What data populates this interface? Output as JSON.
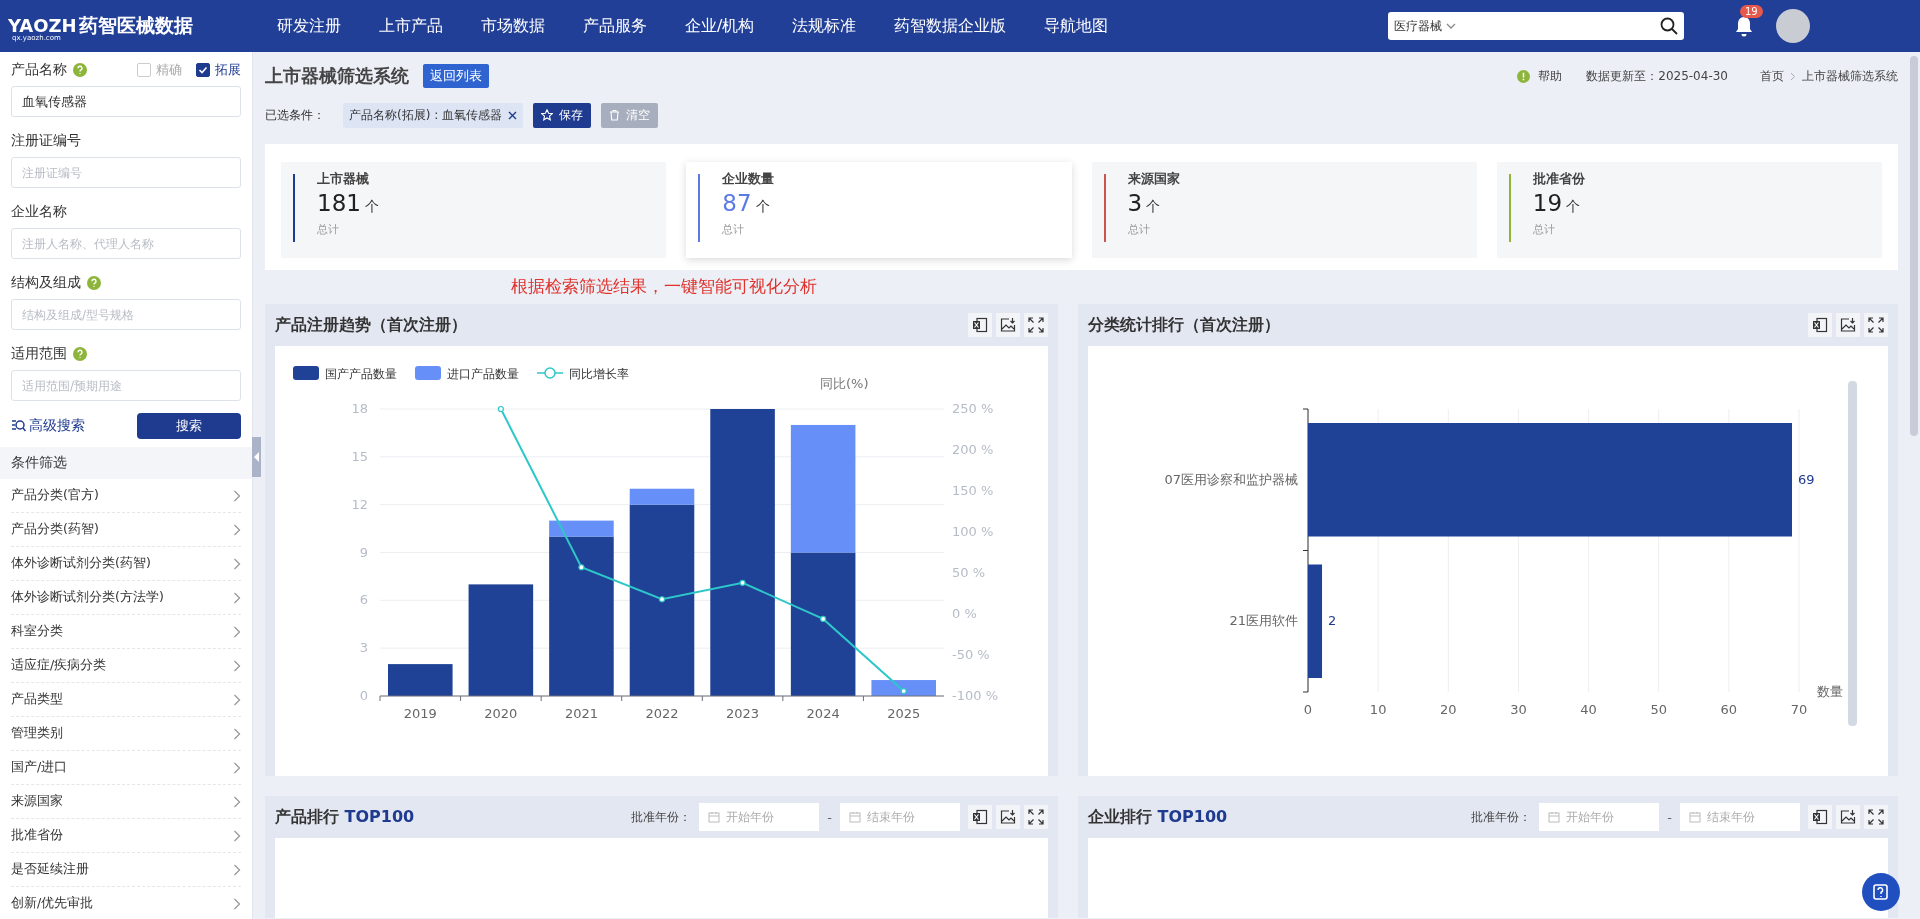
{
  "topbar": {
    "logo": "YAOZH",
    "logo_name": "药智医械数据",
    "logo_url": "qx.yaozh.com",
    "nav": [
      "研发注册",
      "上市产品",
      "市场数据",
      "产品服务",
      "企业/机构",
      "法规标准",
      "药智数据企业版",
      "导航地图"
    ],
    "search": {
      "scope": "医疗器械"
    },
    "notifications": "19"
  },
  "sidebar": {
    "fields": [
      {
        "label": "产品名称",
        "help": true,
        "value": "血氧传感器",
        "options": [
          {
            "label": "精确",
            "checked": false
          },
          {
            "label": "拓展",
            "checked": true
          }
        ]
      },
      {
        "label": "注册证编号",
        "help": false,
        "placeholder": "注册证编号"
      },
      {
        "label": "企业名称",
        "help": false,
        "placeholder": "注册人名称、代理人名称"
      },
      {
        "label": "结构及组成",
        "help": true,
        "placeholder": "结构及组成/型号规格"
      },
      {
        "label": "适用范围",
        "help": true,
        "placeholder": "适用范围/预期用途"
      }
    ],
    "advanced": "高级搜索",
    "search_button": "搜索",
    "filter_title": "条件筛选",
    "filters": [
      "产品分类(官方)",
      "产品分类(药智)",
      "体外诊断试剂分类(药智)",
      "体外诊断试剂分类(方法学)",
      "科室分类",
      "适应症/疾病分类",
      "产品类型",
      "管理类别",
      "国产/进口",
      "来源国家",
      "批准省份",
      "是否延续注册",
      "创新/优先审批"
    ]
  },
  "header": {
    "title": "上市器械筛选系统",
    "back_button": "返回列表",
    "help": "帮助",
    "updated": "数据更新至：2025-04-30",
    "breadcrumb": [
      "首页",
      "上市器械筛选系统"
    ]
  },
  "conditions": {
    "label": "已选条件：",
    "tags": [
      "产品名称(拓展) : 血氧传感器"
    ],
    "buttons": [
      {
        "label": "保存",
        "disabled": false
      },
      {
        "label": "清空",
        "disabled": true
      }
    ]
  },
  "stats": [
    {
      "label": "上市器械",
      "value": "181",
      "unit": "个",
      "note": "总计",
      "color": "#1f3b8f",
      "selected": false
    },
    {
      "label": "企业数量",
      "value": "87",
      "unit": "个",
      "note": "总计",
      "color": "#5b7be0",
      "selected": true
    },
    {
      "label": "来源国家",
      "value": "3",
      "unit": "个",
      "note": "总计",
      "color": "#c9554e",
      "selected": false
    },
    {
      "label": "批准省份",
      "value": "19",
      "unit": "个",
      "note": "总计",
      "color": "#8db53b",
      "selected": false
    }
  ],
  "annotation": "根据检索筛选结果，一键智能可视化分析",
  "trend_card": {
    "title": "产品注册趋势（首次注册）",
    "layers": [
      {
        "chart_data": {
          "type": "bar",
          "stacked": true,
          "legend": "top",
          "grid": true,
          "categories": [
            "2019",
            "2020",
            "2021",
            "2022",
            "2023",
            "2024",
            "2025"
          ],
          "series": [
            {
              "name": "国产产品数量",
              "color": "#1f4196",
              "values": [
                2,
                7,
                10,
                12,
                18,
                9,
                0
              ]
            },
            {
              "name": "进口产品数量",
              "color": "#6690f8",
              "values": [
                0,
                0,
                1,
                1,
                0,
                8,
                1
              ]
            }
          ],
          "ylim": [
            0,
            18
          ],
          "yticks": [
            0,
            3,
            6,
            9,
            12,
            15,
            18
          ]
        }
      },
      {
        "chart_data": {
          "type": "line",
          "legend": "top",
          "ylabel": "同比(%)",
          "ylim": [
            -100,
            250
          ],
          "yticks": [
            {
              "value": -100,
              "label": "-100 %"
            },
            {
              "value": -50,
              "label": "-50 %"
            },
            {
              "value": 0,
              "label": "0 %"
            },
            {
              "value": 50,
              "label": "50 %"
            },
            {
              "value": 100,
              "label": "100 %"
            },
            {
              "value": 150,
              "label": "150 %"
            },
            {
              "value": 200,
              "label": "200 %"
            },
            {
              "value": 250,
              "label": "250 %"
            }
          ],
          "series": [
            {
              "name": "同比增长率",
              "color": "#2ec7c9",
              "marker": "circle",
              "values": [
                null,
                250,
                57,
                18,
                38,
                -6,
                -94
              ]
            }
          ]
        }
      }
    ]
  },
  "class_card": {
    "title": "分类统计排行（首次注册）",
    "chart_data": {
      "type": "bar",
      "orientation": "horizontal",
      "grid": true,
      "categories": [
        "07医用诊察和监护器械",
        "21医用软件"
      ],
      "series": [
        {
          "color": "#1f4196",
          "values": [
            69,
            2
          ]
        }
      ],
      "xlabel": "数量",
      "xlim": [
        0,
        70
      ],
      "xticks": [
        0,
        10,
        20,
        30,
        40,
        50,
        60,
        70
      ],
      "data_labels": true
    }
  },
  "rank_cards": [
    {
      "title": "产品排行",
      "accent": "TOP100",
      "year_label": "批准年份：",
      "start_placeholder": "开始年份",
      "separator": "-",
      "end_placeholder": "结束年份"
    },
    {
      "title": "企业排行",
      "accent": "TOP100",
      "year_label": "批准年份：",
      "start_placeholder": "开始年份",
      "separator": "-",
      "end_placeholder": "结束年份"
    }
  ]
}
